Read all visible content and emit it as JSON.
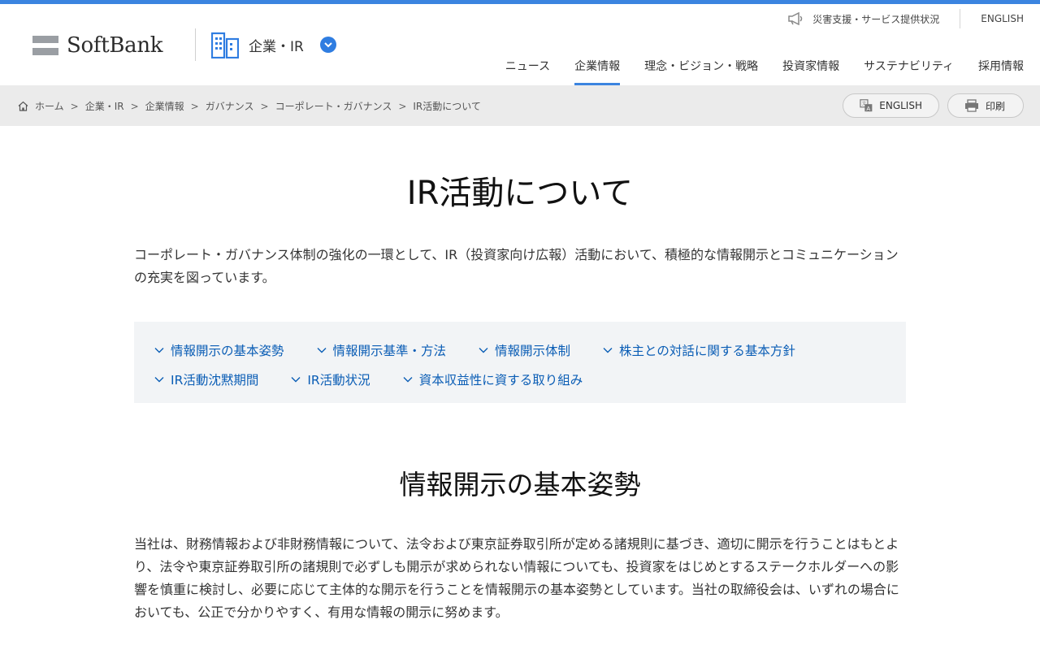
{
  "header": {
    "logo_text": "SoftBank",
    "section_label": "企業・IR",
    "util_nav": {
      "disaster": "災害支援・サービス提供状況",
      "english": "ENGLISH"
    },
    "main_nav": [
      {
        "label": "ニュース"
      },
      {
        "label": "企業情報",
        "active": true
      },
      {
        "label": "理念・ビジョン・戦略"
      },
      {
        "label": "投資家情報"
      },
      {
        "label": "サステナビリティ"
      },
      {
        "label": "採用情報"
      }
    ],
    "accent_color": "#3b84e0"
  },
  "breadcrumb": {
    "items": [
      "ホーム",
      "企業・IR",
      "企業情報",
      "ガバナンス",
      "コーポレート・ガバナンス",
      "IR活動について"
    ],
    "separator": ">"
  },
  "actions": {
    "english": "ENGLISH",
    "print": "印刷"
  },
  "page": {
    "title": "IR活動について",
    "lead": "コーポレート・ガバナンス体制の強化の一環として、IR（投資家向け広報）活動において、積極的な情報開示とコミュニケーションの充実を図っています。",
    "anchors_row1": [
      "情報開示の基本姿勢",
      "情報開示基準・方法",
      "情報開示体制",
      "株主との対話に関する基本方針"
    ],
    "anchors_row2": [
      "IR活動沈黙期間",
      "IR活動状況",
      "資本収益性に資する取り組み"
    ],
    "section_title": "情報開示の基本姿勢",
    "section_body": "当社は、財務情報および非財務情報について、法令および東京証券取引所が定める諸規則に基づき、適切に開示を行うことはもとより、法令や東京証券取引所の諸規則で必ずしも開示が求められない情報についても、投資家をはじめとするステークホルダーへの影響を慎重に検討し、必要に応じて主体的な開示を行うことを情報開示の基本姿勢としています。当社の取締役会は、いずれの場合においても、公正で分かりやすく、有用な情報の開示に努めます。",
    "link_color": "#0a5db5"
  }
}
